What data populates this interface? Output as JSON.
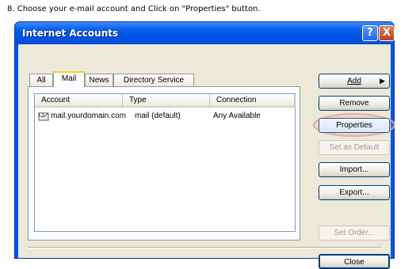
{
  "instruction": "8. Choose your e-mail account and Click on \"Properties\" button.",
  "window": {
    "title": "Internet Accounts",
    "help_label": "?",
    "close_label": "X"
  },
  "tabs": [
    {
      "label": "All"
    },
    {
      "label": "Mail",
      "active": true
    },
    {
      "label": "News"
    },
    {
      "label": "Directory Service"
    }
  ],
  "list": {
    "columns": [
      "Account",
      "Type",
      "Connection"
    ],
    "rows": [
      {
        "account": "mail.yourdomain.com",
        "type": "mail (default)",
        "connection": "Any Available",
        "icon": "mail-account-icon"
      }
    ]
  },
  "buttons": {
    "add": {
      "label": "Add",
      "arrow": "▶"
    },
    "remove": {
      "label": "Remove"
    },
    "properties": {
      "label": "Properties"
    },
    "set_default": {
      "label": "Set as Default"
    },
    "import": {
      "label": "Import..."
    },
    "export": {
      "label": "Export..."
    },
    "set_order": {
      "label": "Set Order..."
    },
    "close": {
      "label": "Close"
    }
  },
  "colors": {
    "titlebar": "#0054e3",
    "dialog_bg": "#ece9d8",
    "highlight": "#e9a9a0"
  }
}
